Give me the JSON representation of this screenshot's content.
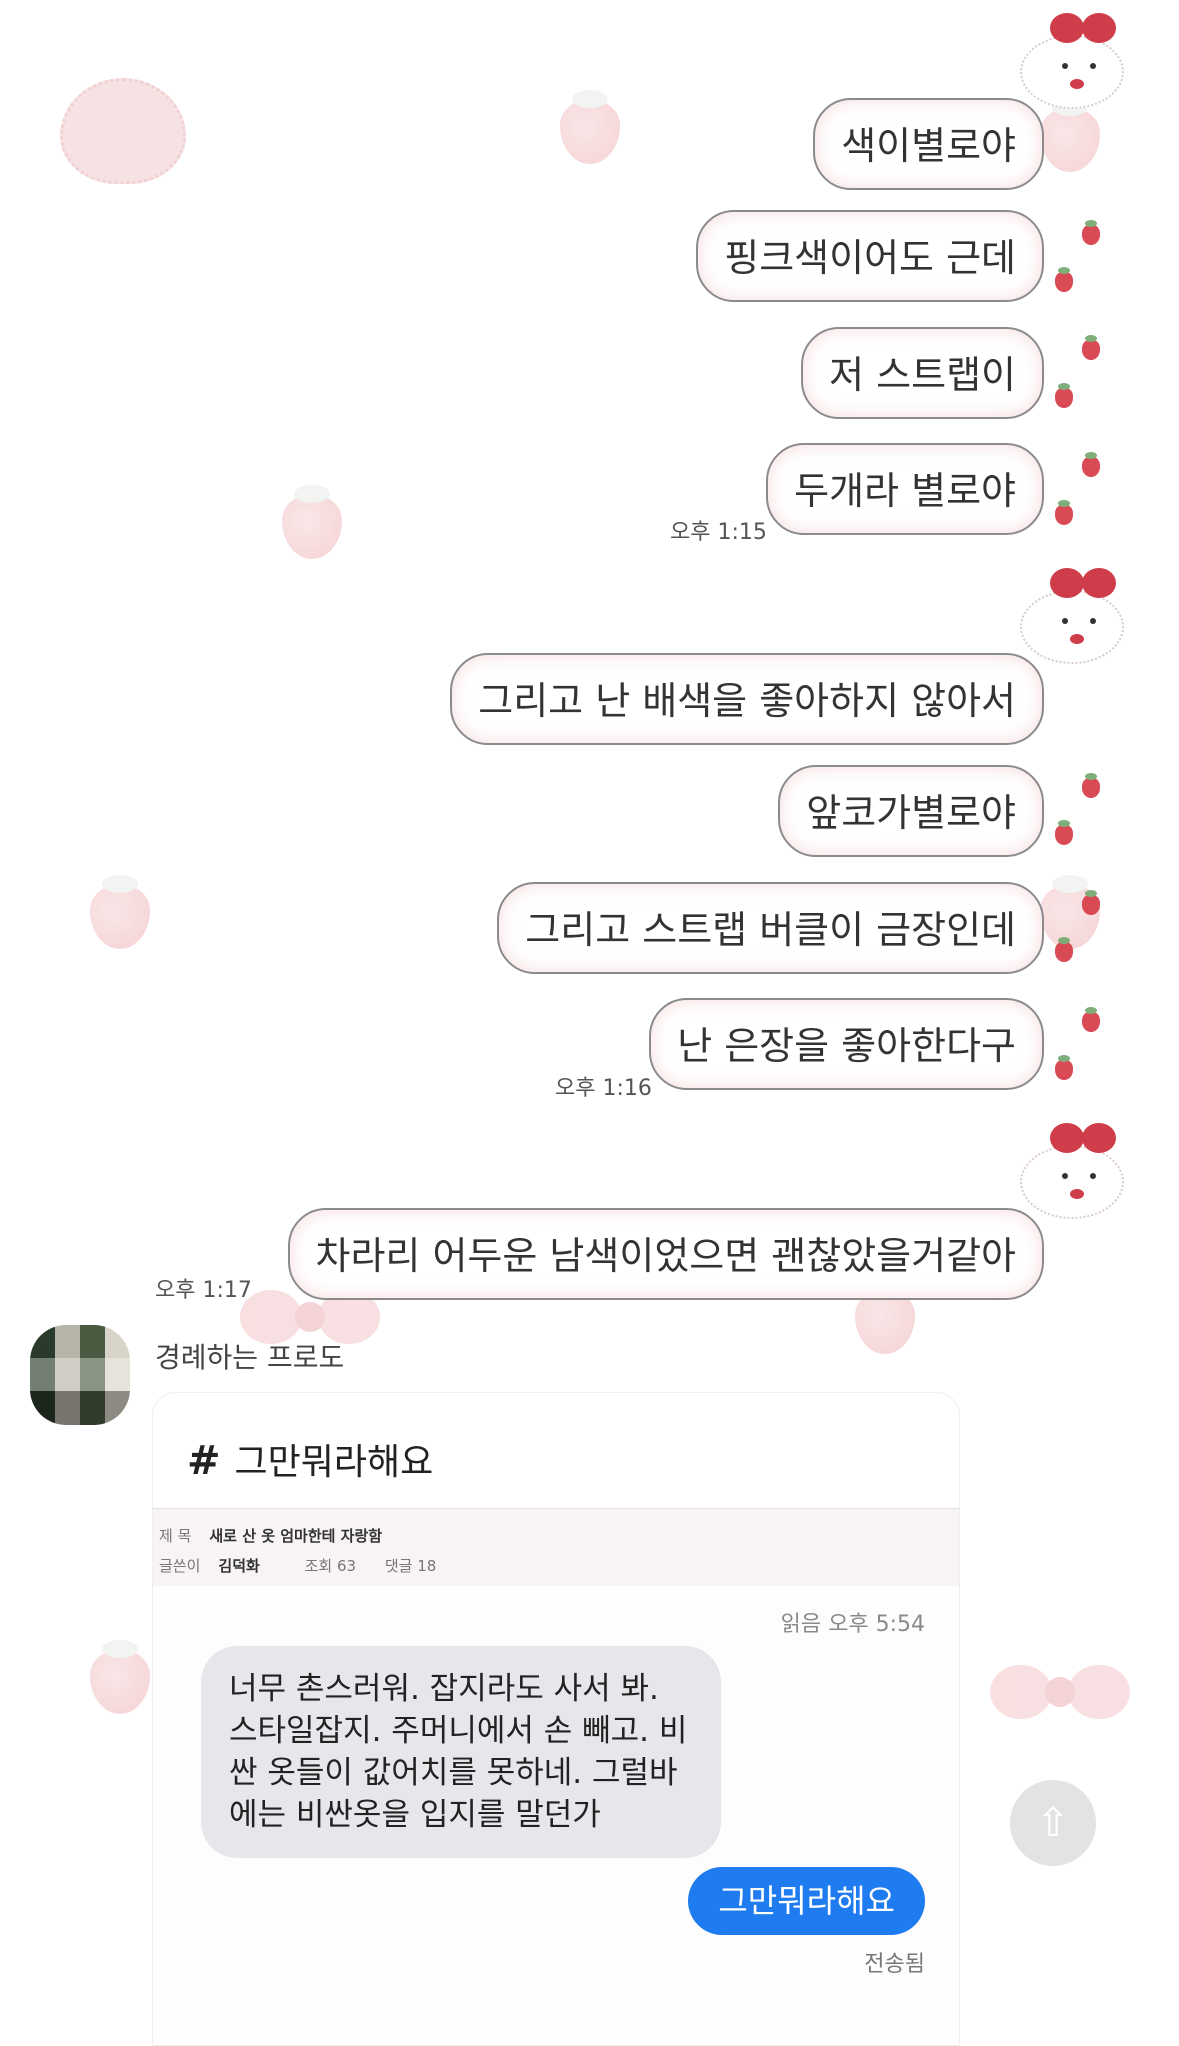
{
  "messages": [
    {
      "text": "색이별로야"
    },
    {
      "text": "핑크색이어도 근데"
    },
    {
      "text": "저 스트랩이"
    },
    {
      "text": "두개라 별로야"
    },
    {
      "text": "그리고 난 배색을 좋아하지 않아서"
    },
    {
      "text": "앞코가별로야"
    },
    {
      "text": "그리고 스트랩 버클이 금장인데"
    },
    {
      "text": "난 은장을 좋아한다구"
    },
    {
      "text": "차라리 어두운 남색이었으면 괜찮았을거같아"
    }
  ],
  "timestamps": {
    "t1": "오후 1:15",
    "t2": "오후 1:16",
    "t3": "오후 1:17"
  },
  "sender": {
    "name": "경례하는 프로도"
  },
  "card": {
    "title": "그만뭐라해요",
    "hash_symbol": "#",
    "board": {
      "subject_label": "제 목",
      "subject": "새로 산 옷 엄마한테 자랑함",
      "author_label": "글쓴이",
      "author": "김덕화",
      "views_label": "조회",
      "views": "63",
      "comments_label": "댓글",
      "comments": "18"
    },
    "read_time": "읽음 오후 5:54",
    "incoming_sms": "너무 촌스러워. 잡지라도 사서 봐. 스타일잡지. 주머니에서 손 빼고. 비싼 옷들이 값어치를 못하네. 그럴바에는 비싼옷을 입지를 말던가",
    "outgoing_sms": "그만뭐라해요",
    "sent_status": "전송됨"
  },
  "icons": {
    "share": "share-icon"
  },
  "colors": {
    "accent_blue": "#1f7bf0",
    "bubble_border": "#8b8b8b",
    "bow_red": "#cf3d4a"
  }
}
